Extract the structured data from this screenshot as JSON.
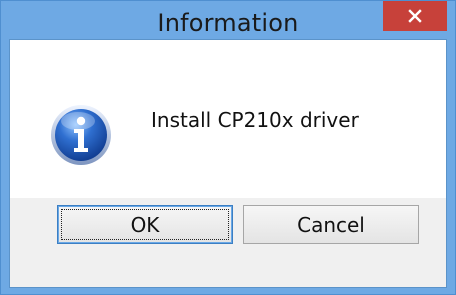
{
  "window": {
    "title": "Information"
  },
  "message": {
    "text": "Install CP210x driver"
  },
  "buttons": {
    "ok_label": "OK",
    "cancel_label": "Cancel"
  },
  "icons": {
    "close": "close-icon",
    "info": "information-icon"
  },
  "colors": {
    "frame": "#6ea9e4",
    "close_button": "#c7413a",
    "client_background": "#f0f0f0",
    "content_background": "#ffffff"
  }
}
